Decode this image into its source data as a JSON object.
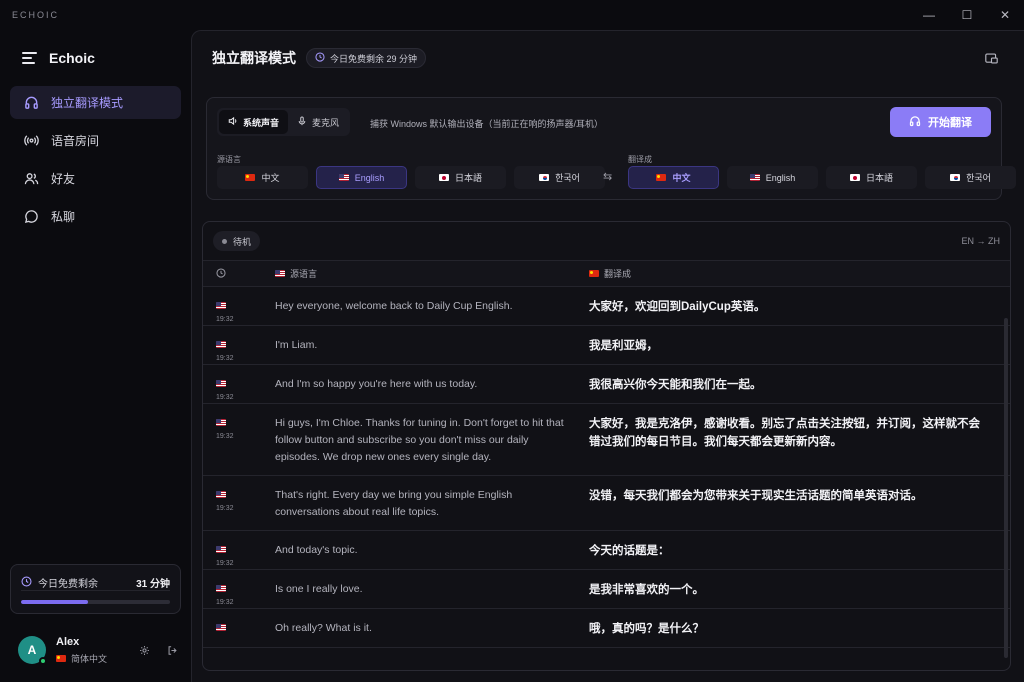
{
  "window": {
    "app_title": "ECHOIC",
    "minimize_icon": "—",
    "maximize_icon": "☐",
    "close_icon": "✕"
  },
  "sidebar": {
    "brand": "Echoic",
    "items": [
      {
        "label": "独立翻译模式",
        "icon": "headphones-icon",
        "active": true
      },
      {
        "label": "语音房间",
        "icon": "broadcast-icon",
        "active": false
      },
      {
        "label": "好友",
        "icon": "users-icon",
        "active": false
      },
      {
        "label": "私聊",
        "icon": "chat-icon",
        "active": false
      }
    ],
    "quota": {
      "label": "今日免费剩余",
      "value": "31 分钟",
      "progress": 0.45
    },
    "user": {
      "avatar_letter": "A",
      "name": "Alex",
      "language": "简体中文"
    }
  },
  "header": {
    "title": "独立翻译模式",
    "pill": "今日免费剩余 29 分钟"
  },
  "controls": {
    "source_tabs": [
      "系统声音",
      "麦克风"
    ],
    "active_source": 0,
    "capture_note": "捕获 Windows 默认输出设备（当前正在响的扬声器/耳机）",
    "start_button": "开始翻译",
    "source_label": "源语言",
    "target_label": "翻译成",
    "source_langs": [
      {
        "flag": "cn",
        "label": "中文",
        "selected": false
      },
      {
        "flag": "us",
        "label": "English",
        "selected": true
      },
      {
        "flag": "jp",
        "label": "日本語",
        "selected": false
      },
      {
        "flag": "kr",
        "label": "한국어",
        "selected": false
      }
    ],
    "target_langs": [
      {
        "flag": "cn",
        "label": "中文",
        "selected": true
      },
      {
        "flag": "us",
        "label": "English",
        "selected": false
      },
      {
        "flag": "jp",
        "label": "日本語",
        "selected": false
      },
      {
        "flag": "kr",
        "label": "한국어",
        "selected": false
      }
    ],
    "swap_icon": "⇆"
  },
  "transcript": {
    "status": "待机",
    "direction": "EN → ZH",
    "columns": {
      "source": "源语言",
      "target": "翻译成"
    },
    "rows": [
      {
        "time": "19:32",
        "source": "Hey everyone, welcome back to Daily Cup English.",
        "target": "大家好，欢迎回到DailyCup英语。"
      },
      {
        "time": "19:32",
        "source": "I'm Liam.",
        "target": "我是利亚姆，"
      },
      {
        "time": "19:32",
        "source": "And I'm so happy you're here with us today.",
        "target": "我很高兴你今天能和我们在一起。"
      },
      {
        "time": "19:32",
        "source": "Hi guys, I'm Chloe. Thanks for tuning in. Don't forget to hit that follow button and subscribe so you don't miss our daily episodes. We drop new ones every single day.",
        "target": "大家好，我是克洛伊，感谢收看。别忘了点击关注按钮，并订阅，这样就不会错过我们的每日节目。我们每天都会更新新内容。"
      },
      {
        "time": "19:32",
        "source": "That's right. Every day we bring you simple English conversations about real life topics.",
        "target": "没错，每天我们都会为您带来关于现实生活话题的简单英语对话。"
      },
      {
        "time": "19:32",
        "source": "And today's topic.",
        "target": "今天的话题是："
      },
      {
        "time": "19:32",
        "source": "Is one I really love.",
        "target": "是我非常喜欢的一个。"
      },
      {
        "time": "",
        "source": "Oh really? What is it.",
        "target": "哦，真的吗？是什么？"
      }
    ]
  },
  "colors": {
    "accent": "#8b7cf6",
    "accent_text": "#a79bff",
    "background": "#0b0b0f",
    "panel": "#111116"
  }
}
